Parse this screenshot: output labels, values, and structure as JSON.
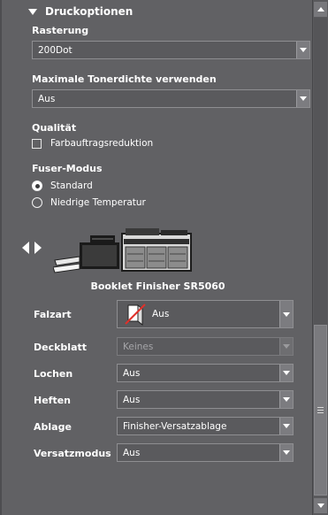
{
  "section": {
    "title": "Druckoptionen",
    "icon": "triangle-down-icon"
  },
  "rasterung": {
    "label": "Rasterung",
    "value": "200Dot"
  },
  "tonerdichte": {
    "label": "Maximale Tonerdichte verwenden",
    "value": "Aus"
  },
  "qualitaet": {
    "label": "Qualität",
    "checkbox_label": "Farbauftragsreduktion",
    "checked": false
  },
  "fuser": {
    "label": "Fuser-Modus",
    "options": [
      {
        "label": "Standard",
        "selected": true
      },
      {
        "label": "Niedrige Temperatur",
        "selected": false
      }
    ]
  },
  "device": {
    "name": "Booklet Finisher SR5060"
  },
  "finisher": {
    "falzart": {
      "label": "Falzart",
      "value": "Aus"
    },
    "deckblatt": {
      "label": "Deckblatt",
      "value": "Keines",
      "disabled": true
    },
    "lochen": {
      "label": "Lochen",
      "value": "Aus"
    },
    "heften": {
      "label": "Heften",
      "value": "Aus"
    },
    "ablage": {
      "label": "Ablage",
      "value": "Finisher-Versatzablage"
    },
    "versatzmodus": {
      "label": "Versatzmodus",
      "value": "Aus"
    }
  },
  "colors": {
    "panel": "#616164",
    "field": "#5a5a5d",
    "accent_red": "#e0302a"
  }
}
